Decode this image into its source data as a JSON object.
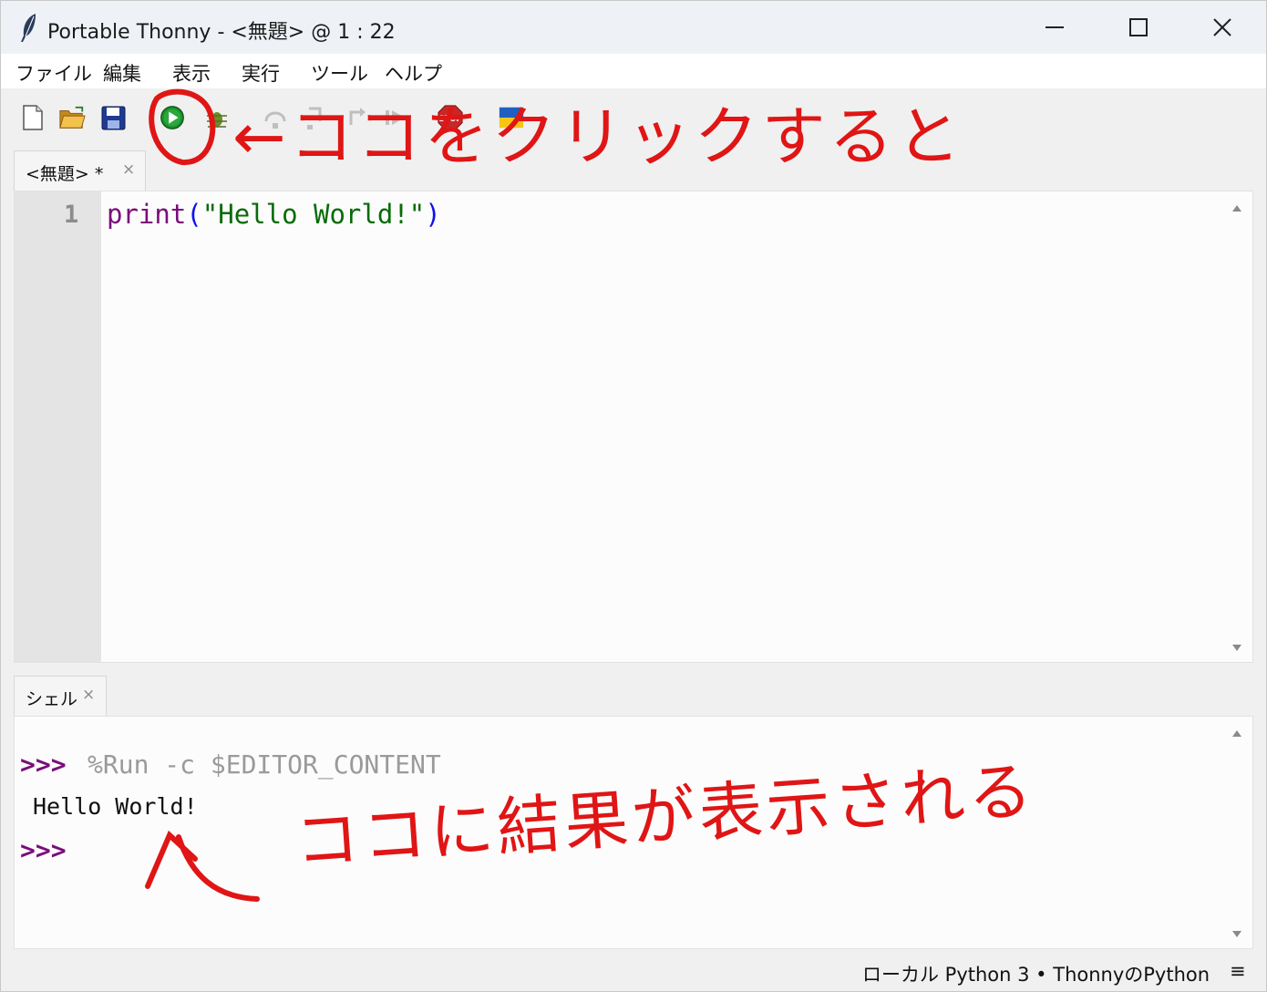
{
  "window": {
    "title": "Portable Thonny  -  <無題>  @  1 : 22",
    "buttons": [
      "minimize",
      "maximize",
      "close"
    ]
  },
  "menu": [
    "ファイル",
    "編集",
    "表示",
    "実行",
    "ツール",
    "ヘルプ"
  ],
  "toolbar": {
    "icons": [
      "new-file-icon",
      "open-folder-icon",
      "save-icon",
      "run-icon",
      "debug-icon",
      "step-over-icon",
      "step-into-icon",
      "step-out-icon",
      "resume-icon",
      "stop-icon",
      "ukraine-flag-icon"
    ],
    "stop_label": "STOP"
  },
  "editor": {
    "tab_label": "<無題> *",
    "tab_close": "×",
    "line_number": "1",
    "code": {
      "func": "print",
      "open": "(",
      "string": "\"Hello World!\"",
      "close": ")"
    }
  },
  "shell": {
    "tab_label": "シェル",
    "tab_close": "×",
    "prompt1": ">>>",
    "command": "%Run -c $EDITOR_CONTENT",
    "output": "Hello World!",
    "prompt2": ">>>"
  },
  "status": {
    "interpreter": "ローカル Python 3  •  ThonnyのPython",
    "menu_glyph": "≡"
  },
  "annotations": {
    "top_note": "←ココをクリックすると",
    "bottom_note": "ココに結果が表示される",
    "color": "#e01515"
  },
  "colors": {
    "keyword": "#7a0e7a",
    "string": "#086b08",
    "paren": "#1111ee",
    "run_green": "#1e8f2e"
  }
}
